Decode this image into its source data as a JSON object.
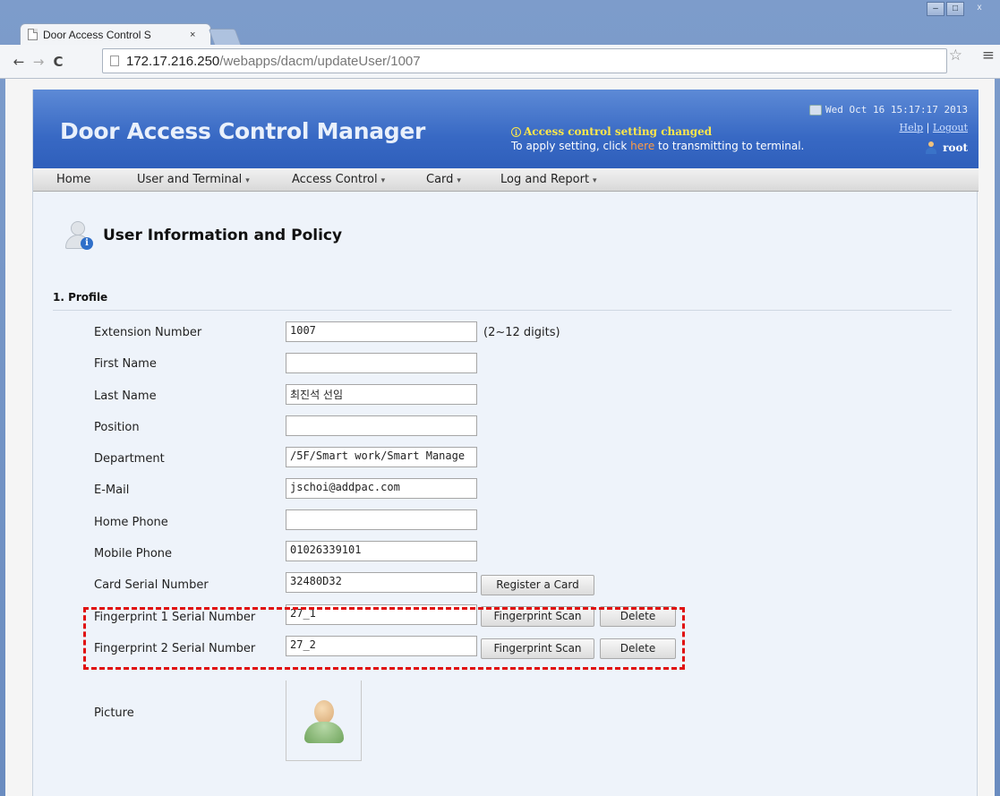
{
  "browser": {
    "tab_title": "Door Access Control S",
    "tab_close": "×",
    "url_host": "172.17.216.250",
    "url_path": "/webapps/dacm/updateUser/1007",
    "win_minimize": "–",
    "win_maximize": "□",
    "win_close": "x"
  },
  "header": {
    "app_title": "Door Access Control Manager",
    "notice_title": "Access control setting changed",
    "notice_pre": "To apply setting, click ",
    "notice_link": "here",
    "notice_post": " to transmitting to terminal.",
    "datetime": "Wed Oct 16 15:17:17 2013",
    "help": "Help",
    "separator": "|",
    "logout": "Logout",
    "user": "root"
  },
  "nav": {
    "items": [
      "Home",
      "User and Terminal",
      "Access Control",
      "Card",
      "Log and Report"
    ],
    "caret": "▾"
  },
  "page": {
    "title": "User Information and Policy",
    "section": "1. Profile"
  },
  "form": {
    "extension_label": "Extension Number",
    "extension_value": "1007",
    "extension_hint": "(2~12 digits)",
    "first_name_label": "First Name",
    "first_name_value": "",
    "last_name_label": "Last Name",
    "last_name_value": "최진석 선임",
    "position_label": "Position",
    "position_value": "",
    "department_label": "Department",
    "department_value": "/5F/Smart work/Smart Manage",
    "email_label": "E-Mail",
    "email_value": "jschoi@addpac.com",
    "home_phone_label": "Home Phone",
    "home_phone_value": "",
    "mobile_phone_label": "Mobile Phone",
    "mobile_phone_value": "01026339101",
    "card_serial_label": "Card Serial Number",
    "card_serial_value": "32480D32",
    "register_card_button": "Register a Card",
    "fp1_label": "Fingerprint 1 Serial Number",
    "fp1_value": "27_1",
    "fp2_label": "Fingerprint 2 Serial Number",
    "fp2_value": "27_2",
    "fingerprint_scan_button": "Fingerprint Scan",
    "delete_button": "Delete",
    "picture_label": "Picture"
  }
}
